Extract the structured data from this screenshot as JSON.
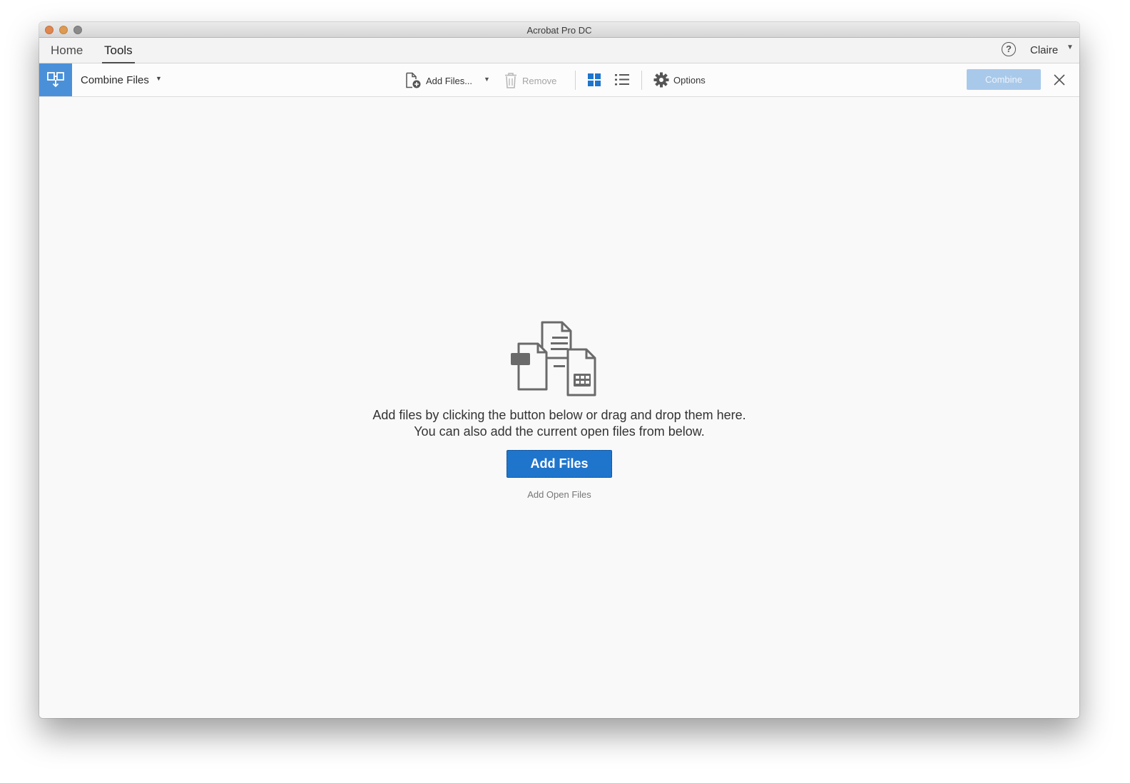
{
  "window": {
    "title": "Acrobat Pro DC"
  },
  "tabs": [
    {
      "label": "Home",
      "active": false
    },
    {
      "label": "Tools",
      "active": true
    }
  ],
  "user": {
    "name": "Claire"
  },
  "toolbar": {
    "tool_name": "Combine Files",
    "add_files_label": "Add Files...",
    "remove_label": "Remove",
    "options_label": "Options",
    "combine_label": "Combine"
  },
  "main": {
    "instruction_line1": "Add files by clicking the button below or drag and drop them here.",
    "instruction_line2": "You can also add the current open files from below.",
    "add_files_button": "Add Files",
    "add_open_files_link": "Add Open Files"
  },
  "colors": {
    "accent": "#1f75cc",
    "tool_badge": "#4a90d9",
    "combine_disabled": "#a9c9ea"
  },
  "icons": {
    "tool_badge": "combine-files-icon",
    "add_files": "file-add-icon",
    "remove": "trash-icon",
    "grid_view": "grid-view-icon",
    "list_view": "list-view-icon",
    "options": "gear-icon",
    "close": "close-icon",
    "help": "help-icon"
  }
}
